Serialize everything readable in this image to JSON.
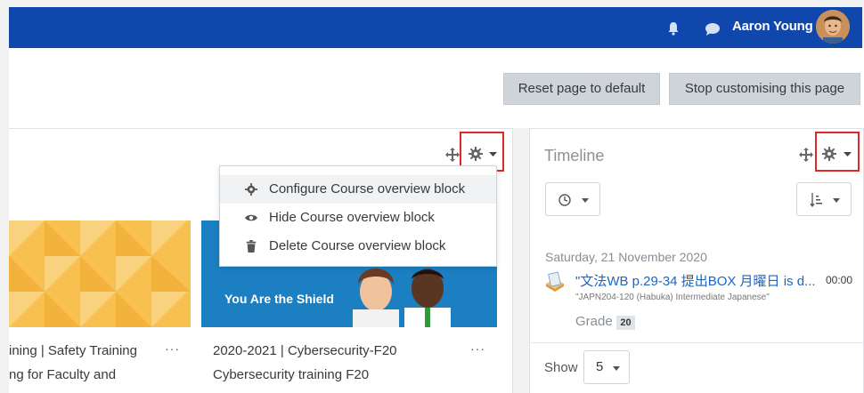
{
  "topbar": {
    "username": "Aaron Young",
    "icons": [
      "bell-icon",
      "chat-icon"
    ],
    "brand_color": "#0f47ad"
  },
  "header": {
    "reset_label": "Reset page to default",
    "stop_label": "Stop customising this page"
  },
  "course_overview": {
    "menu": {
      "configure": "Configure Course overview block",
      "hide": "Hide Course overview block",
      "delete": "Delete Course overview block"
    },
    "cards": [
      {
        "line1": "ining | Safety Training",
        "line2": "ng for Faculty and",
        "more": "···"
      },
      {
        "line1": "2020-2021 | Cybersecurity-F20",
        "line2": "Cybersecurity training F20",
        "more": "···",
        "banner": "You Are the Shield"
      }
    ]
  },
  "timeline": {
    "title": "Timeline",
    "date": "Saturday, 21 November 2020",
    "event": {
      "name": "\"文法WB p.29-34 提出BOX 月曜日 is d...",
      "time": "00:00",
      "course": "\"JAPN204-120 (Habuka) Intermediate Japanese\"",
      "grade_label": "Grade",
      "grade_value": "20"
    },
    "show_label": "Show",
    "show_value": "5"
  },
  "colors": {
    "highlight": "#e02828",
    "link": "#1a66c0",
    "button_bg": "#ced4da"
  }
}
